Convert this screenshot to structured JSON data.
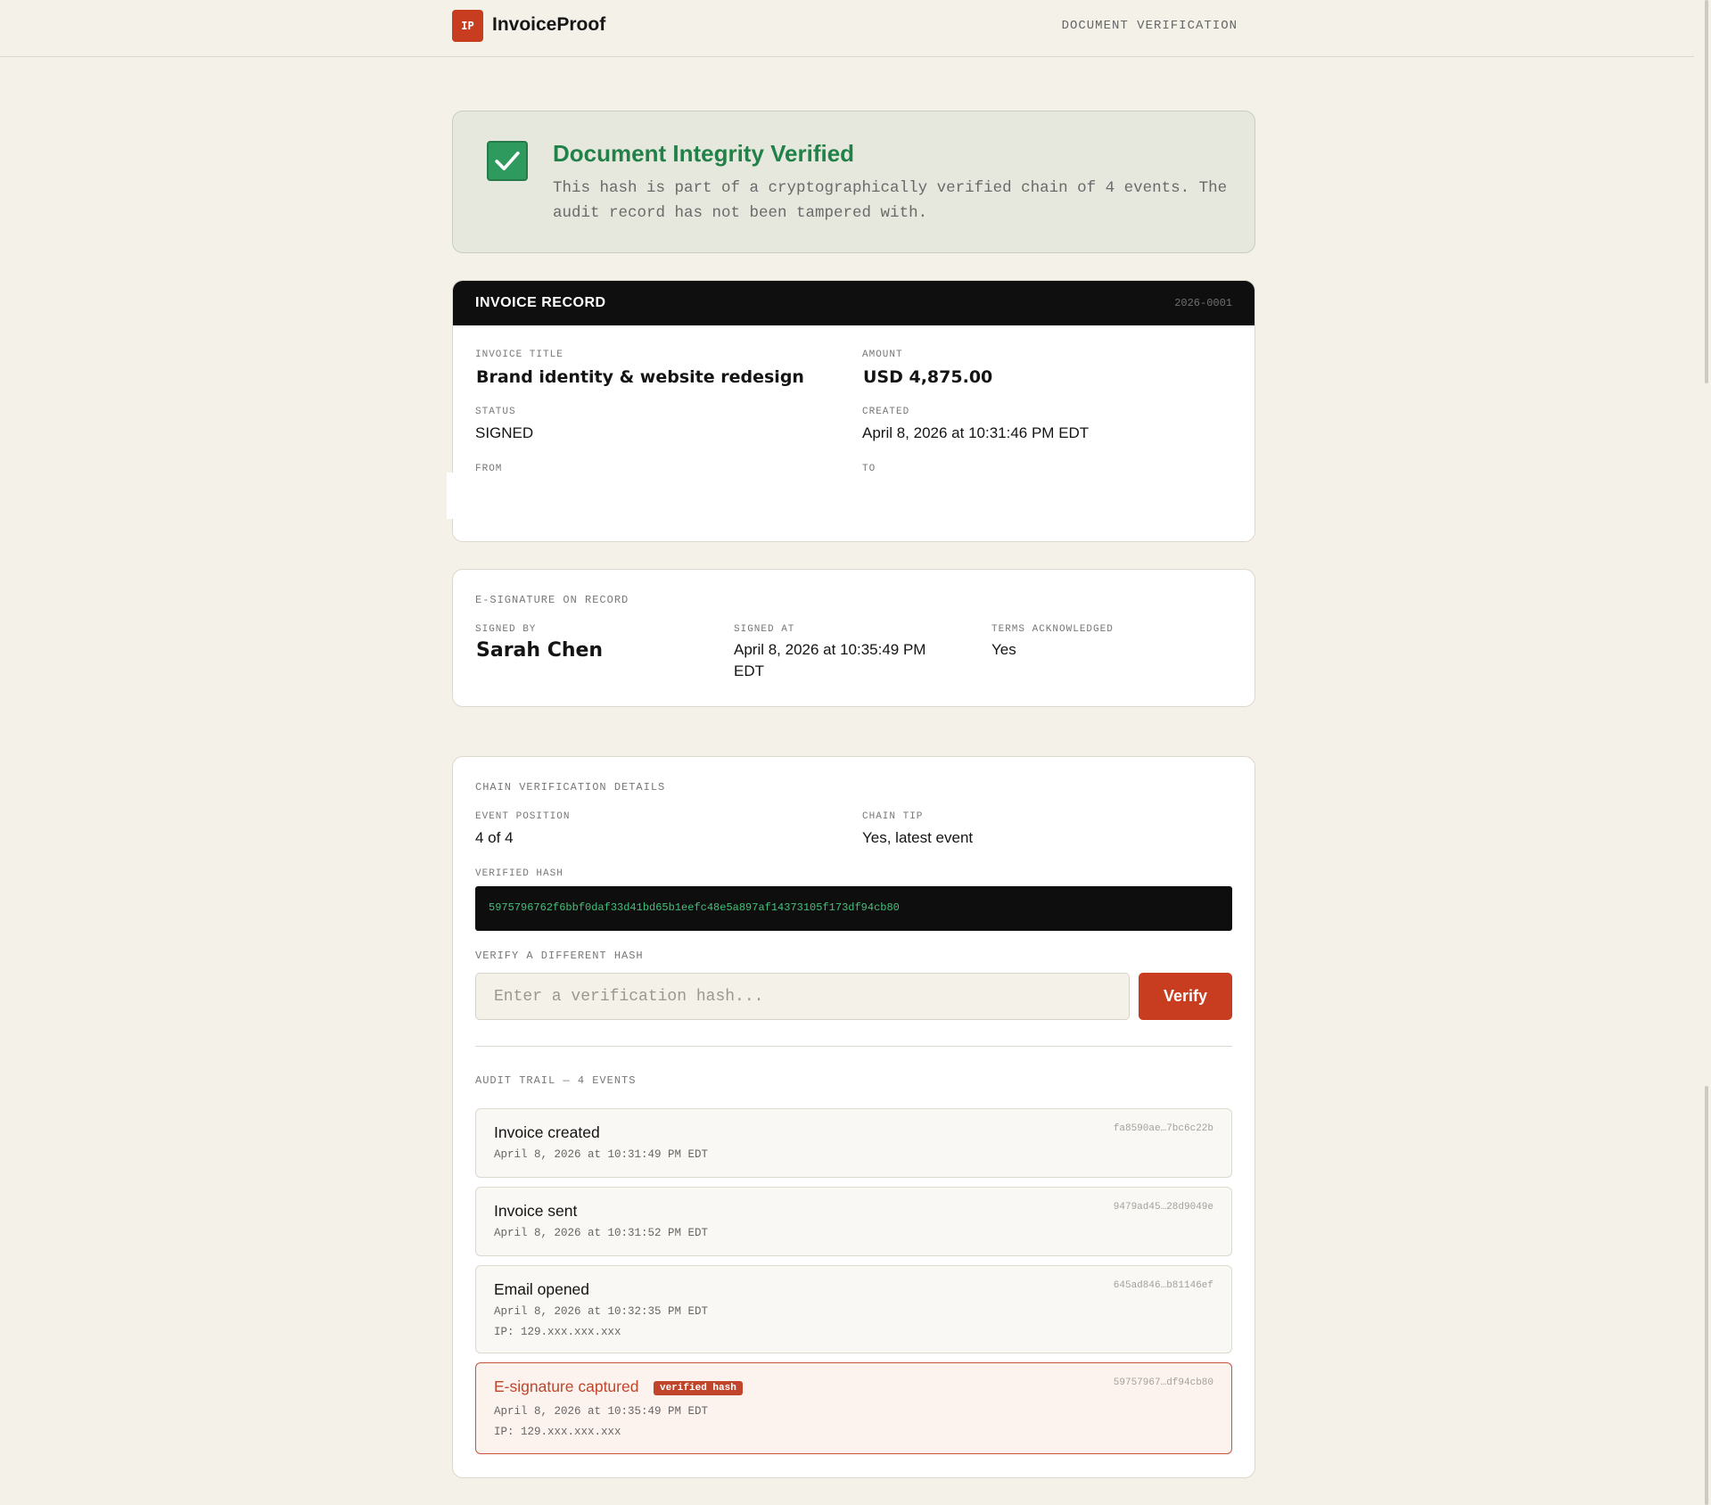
{
  "header": {
    "logo_text": "IP",
    "brand": "InvoiceProof",
    "nav_label": "DOCUMENT VERIFICATION"
  },
  "verification": {
    "title": "Document Integrity Verified",
    "description": "This hash is part of a cryptographically verified chain of 4 events. The audit record has not been tampered with."
  },
  "invoice": {
    "header_title": "INVOICE RECORD",
    "invoice_number": "2026-0001",
    "title_label": "INVOICE TITLE",
    "title": "Brand identity & website redesign",
    "amount_label": "AMOUNT",
    "amount": "USD 4,875.00",
    "status_label": "STATUS",
    "status": "SIGNED",
    "created_label": "CREATED",
    "created": "April 8, 2026 at 10:31:46 PM EDT",
    "from_label": "FROM",
    "to_label": "TO"
  },
  "signature": {
    "section_label": "E-SIGNATURE ON RECORD",
    "signed_by_label": "SIGNED BY",
    "signed_by": "Sarah Chen",
    "signed_at_label": "SIGNED AT",
    "signed_at_line1": "April 8, 2026 at 10:35:49 PM",
    "signed_at_line2": "EDT",
    "terms_label": "TERMS ACKNOWLEDGED",
    "terms": "Yes"
  },
  "chain": {
    "section_label": "CHAIN VERIFICATION DETAILS",
    "position_label": "EVENT POSITION",
    "position": "4 of 4",
    "tip_label": "CHAIN TIP",
    "tip": "Yes, latest event",
    "hash_label": "VERIFIED HASH",
    "hash": "5975796762f6bbf0daf33d41bd65b1eefc48e5a897af14373105f173df94cb80",
    "verify_label": "VERIFY A DIFFERENT HASH",
    "verify_placeholder": "Enter a verification hash...",
    "verify_button": "Verify",
    "audit_label": "AUDIT TRAIL — 4 EVENTS",
    "events": [
      {
        "title": "Invoice created",
        "time": "April 8, 2026 at 10:31:49 PM EDT",
        "hash": "fa8590ae…7bc6c22b"
      },
      {
        "title": "Invoice sent",
        "time": "April 8, 2026 at 10:31:52 PM EDT",
        "hash": "9479ad45…28d9049e"
      },
      {
        "title": "Email opened",
        "time": "April 8, 2026 at 10:32:35 PM EDT",
        "ip": "IP: 129.xxx.xxx.xxx",
        "hash": "645ad846…b81146ef"
      },
      {
        "title": "E-signature captured",
        "badge": "verified hash",
        "time": "April 8, 2026 at 10:35:49 PM EDT",
        "ip": "IP: 129.xxx.xxx.xxx",
        "hash": "59757967…df94cb80"
      }
    ]
  },
  "colors": {
    "accent": "#c83d1f",
    "success": "#228149",
    "hash_text": "#43c07a"
  }
}
